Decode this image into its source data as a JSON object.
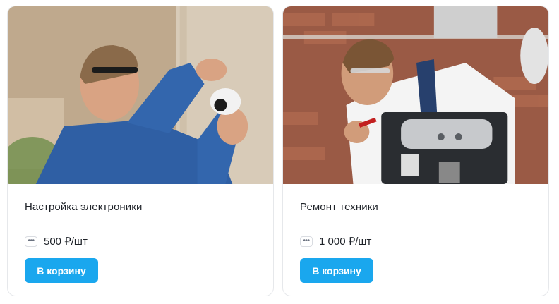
{
  "products": [
    {
      "title": "Настройка электроники",
      "price": "500 ₽/шт",
      "button_label": "В корзину",
      "more_icon": "ellipsis-icon"
    },
    {
      "title": "Ремонт техники",
      "price": "1 000 ₽/шт",
      "button_label": "В корзину",
      "more_icon": "ellipsis-icon"
    }
  ],
  "colors": {
    "accent": "#1aa7ee",
    "text": "#1f2329",
    "border": "#e6e8eb"
  }
}
